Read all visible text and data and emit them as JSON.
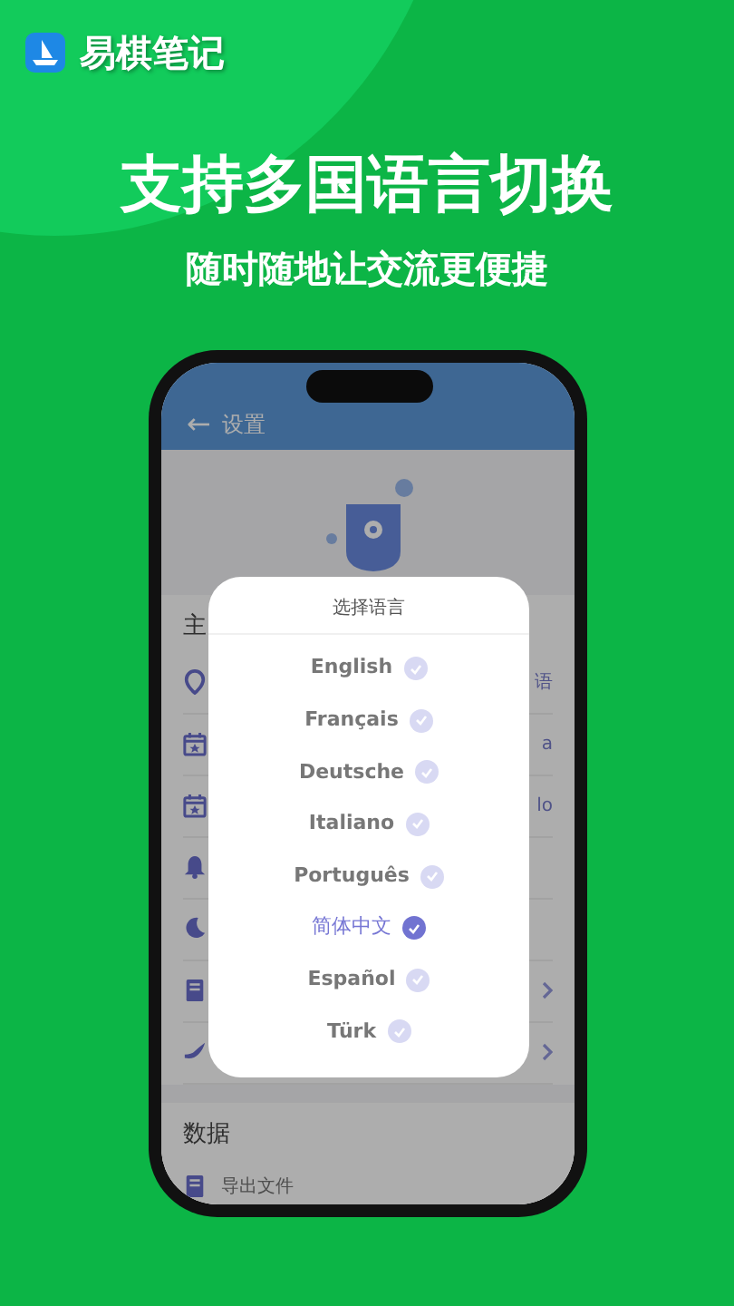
{
  "brand": {
    "name": "易棋笔记"
  },
  "headline": "支持多国语言切换",
  "subheadline": "随时随地让交流更便捷",
  "phone": {
    "screen": {
      "title": "设置",
      "back": "←",
      "section_1": {
        "title": "主"
      },
      "rows": [
        {
          "kind": "value",
          "value": "语"
        },
        {
          "kind": "value",
          "value": "a"
        },
        {
          "kind": "value",
          "value": "lo"
        },
        {
          "kind": "blank"
        },
        {
          "kind": "blank"
        },
        {
          "kind": "chevron"
        },
        {
          "kind": "chevron"
        }
      ],
      "section_2": {
        "title": "数据",
        "rows": [
          {
            "label": "导出文件"
          }
        ]
      },
      "dialog": {
        "title": "选择语言",
        "options": [
          {
            "label": "English",
            "selected": false
          },
          {
            "label": "Français",
            "selected": false
          },
          {
            "label": "Deutsche",
            "selected": false
          },
          {
            "label": "Italiano",
            "selected": false
          },
          {
            "label": "Português",
            "selected": false
          },
          {
            "label": "简体中文",
            "selected": true
          },
          {
            "label": "Español",
            "selected": false
          },
          {
            "label": "Türk",
            "selected": false
          }
        ]
      }
    }
  }
}
